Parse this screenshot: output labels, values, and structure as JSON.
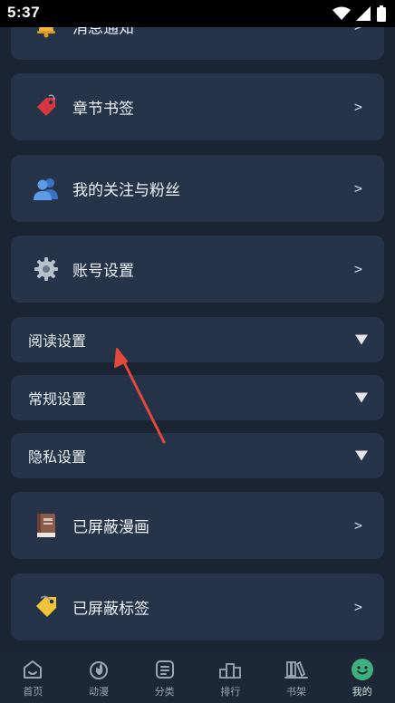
{
  "status_bar": {
    "time": "5:37"
  },
  "menu": {
    "items": [
      {
        "label": "消息通知",
        "type": "link",
        "chevron": ">",
        "icon": "bell-icon"
      },
      {
        "label": "章节书签",
        "type": "link",
        "chevron": ">",
        "icon": "bookmark-tag-icon"
      },
      {
        "label": "我的关注与粉丝",
        "type": "link",
        "chevron": ">",
        "icon": "users-icon"
      },
      {
        "label": "账号设置",
        "type": "link",
        "chevron": ">",
        "icon": "gear-icon"
      },
      {
        "label": "阅读设置",
        "type": "expand",
        "icon": "caret-down-icon"
      },
      {
        "label": "常规设置",
        "type": "expand",
        "icon": "caret-down-icon"
      },
      {
        "label": "隐私设置",
        "type": "expand",
        "icon": "caret-down-icon"
      },
      {
        "label": "已屏蔽漫画",
        "type": "link",
        "chevron": ">",
        "icon": "book-icon"
      },
      {
        "label": "已屏蔽标签",
        "type": "link",
        "chevron": ">",
        "icon": "price-tag-icon"
      }
    ]
  },
  "tabbar": {
    "tabs": [
      {
        "label": "首页",
        "icon": "home-icon",
        "active": false
      },
      {
        "label": "动漫",
        "icon": "fire-icon",
        "active": false
      },
      {
        "label": "分类",
        "icon": "category-icon",
        "active": false
      },
      {
        "label": "排行",
        "icon": "podium-icon",
        "active": false
      },
      {
        "label": "书架",
        "icon": "bookshelf-icon",
        "active": false
      },
      {
        "label": "我的",
        "icon": "profile-face-icon",
        "active": true
      }
    ]
  },
  "colors": {
    "background": "#1a2433",
    "card": "#26344a",
    "annotation_arrow": "#e2483c",
    "active_tab": "#3fb07a"
  }
}
